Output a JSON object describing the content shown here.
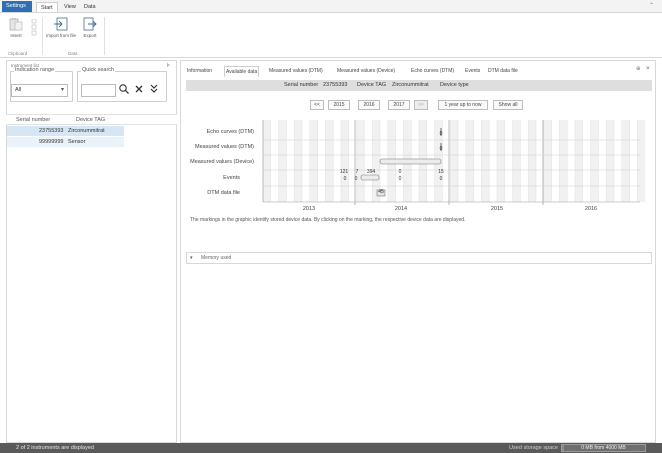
{
  "ribbon": {
    "tabs": [
      "Settings",
      "Start",
      "View",
      "Data"
    ],
    "buttons": {
      "insert": "Insert",
      "import_from_file": "Import from file",
      "export": "Export"
    },
    "groups": {
      "clipboard": "Clipboard",
      "data": "Data"
    }
  },
  "left_panel": {
    "title": "Instrument list",
    "indication_range": {
      "legend": "Indication range",
      "value": "All"
    },
    "quick_search": {
      "legend": "Quick search"
    },
    "columns": [
      "Serial number",
      "Device TAG"
    ],
    "rows": [
      {
        "serial": "23755393",
        "tag": "Zirconummitrat"
      },
      {
        "serial": "99999999",
        "tag": "Sensor"
      }
    ]
  },
  "right_panel": {
    "tabs": [
      "Information",
      "Available data",
      "Measured values (DTM)",
      "Measured values (Device)",
      "Echo curves (DTM)",
      "Events",
      "DTM data file"
    ],
    "device_bar": {
      "serial_label": "Serial number",
      "serial_value": "23755393",
      "tag_label": "Device TAG",
      "tag_value": "Zirconummitrat",
      "type_label": "Device type"
    },
    "nav": {
      "prev": "<<",
      "y1": "2015",
      "y2": "2016",
      "y3": "2017",
      "next": ">>",
      "range": "1 year up to now",
      "show_all": "Show all"
    },
    "timeline": {
      "rows": [
        "Echo curves (DTM)",
        "Measured values (DTM)",
        "Measured values (Device)",
        "Events",
        "DTM data file"
      ],
      "years": [
        "2013",
        "2014",
        "2015",
        "2016"
      ],
      "markers": {
        "echo_count": "0",
        "mv_dtm_count": "0",
        "events_top": [
          "121",
          "7",
          "394",
          "0",
          "15"
        ],
        "events_bottom": [
          "0",
          "0",
          "0",
          "0"
        ],
        "dtm_count": "45"
      }
    },
    "note": "The markings in the graphic identify stored device data. By clicking on the marking, the respective device data are displayed.",
    "memory_used_label": "Memory used"
  },
  "status": {
    "left": "2 of 2 instruments are displayed",
    "right": "Used storage space",
    "storage_text": "0 MB from 4000 MB",
    "storage_fraction": 0.02
  },
  "colors": {
    "accent": "#2e6fb3",
    "selection": "#d7e6f5",
    "statusbar": "#5a5a5a"
  }
}
